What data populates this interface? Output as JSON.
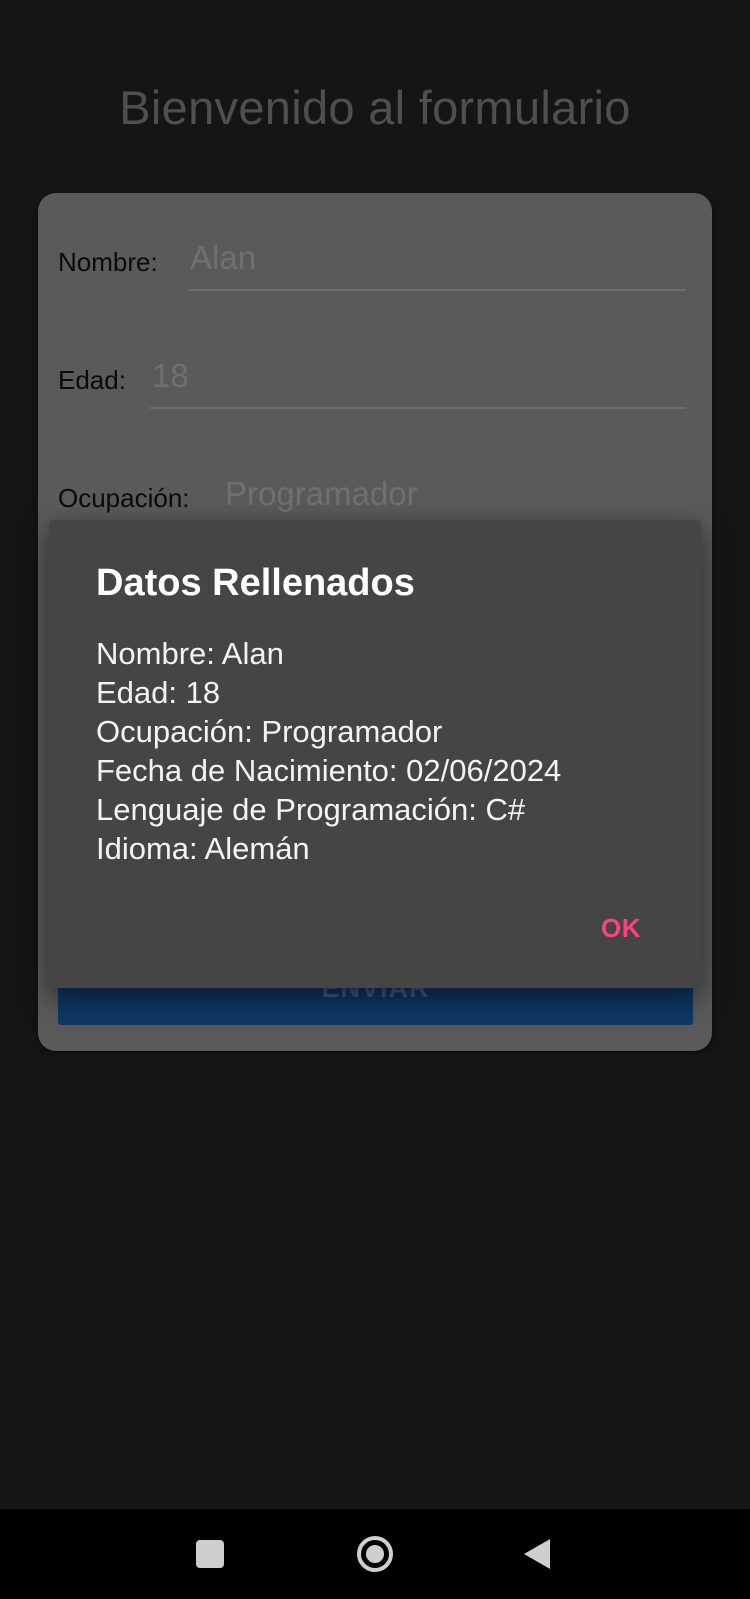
{
  "header": {
    "title": "Bienvenido al formulario"
  },
  "form": {
    "fields": [
      {
        "label": "Nombre:",
        "value": "Alan"
      },
      {
        "label": "Edad:",
        "value": "18"
      },
      {
        "label": "Ocupación:",
        "value": "Programador"
      }
    ],
    "submit_label": "ENVIAR"
  },
  "dialog": {
    "title": "Datos Rellenados",
    "lines": [
      "Nombre: Alan",
      "Edad: 18",
      "Ocupación: Programador",
      "Fecha de Nacimiento: 02/06/2024",
      "Lenguaje de Programación: C#",
      "Idioma: Alemán"
    ],
    "ok_label": "OK"
  },
  "navbar": {
    "icons": [
      "recents-square-icon",
      "home-circle-icon",
      "back-triangle-icon"
    ]
  },
  "colors": {
    "background": "#151515",
    "card": "#5a5a5a",
    "dialog": "#454545",
    "accent": "#ff4081",
    "button": "#0f3866"
  }
}
